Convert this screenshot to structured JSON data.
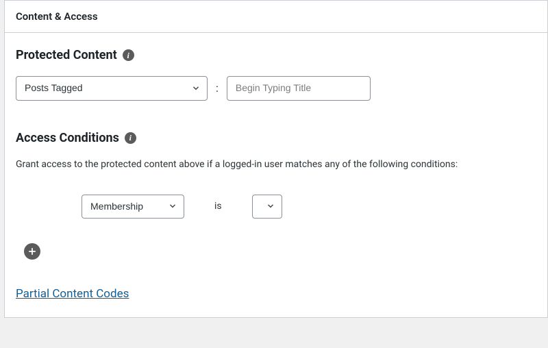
{
  "panel": {
    "header": "Content & Access"
  },
  "protected": {
    "title": "Protected Content",
    "type_selected": "Posts Tagged",
    "input_placeholder": "Begin Typing Title"
  },
  "access": {
    "title": "Access Conditions",
    "description": "Grant access to the protected content above if a logged-in user matches any of the following conditions:",
    "condition_selected": "Membership",
    "operator": "is",
    "value_selected": ""
  },
  "link": {
    "partial_codes": "Partial Content Codes"
  }
}
